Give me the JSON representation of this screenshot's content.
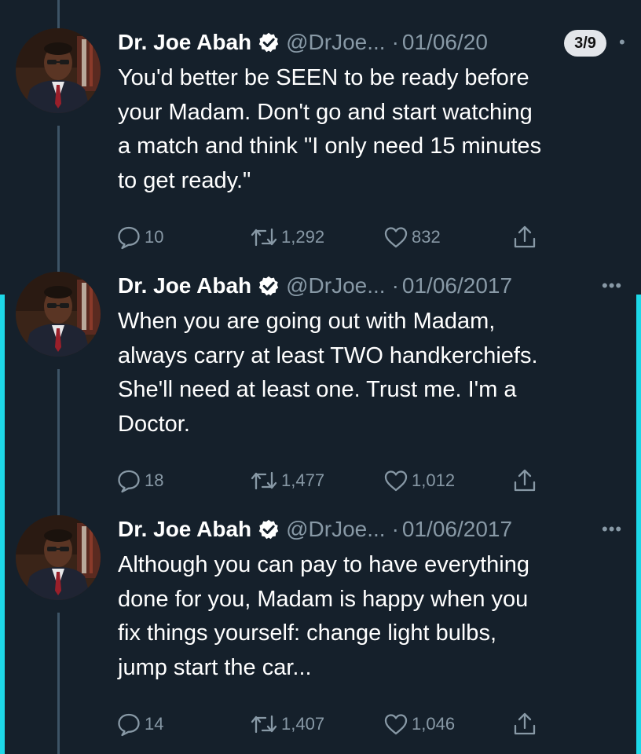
{
  "tweets": [
    {
      "name": "Dr. Joe Abah",
      "handle": "@DrJoe...",
      "date": "01/06/20",
      "text_lines": [
        "You'd better be SEEN to be ready before",
        "your Madam. Don't go and start watching",
        "a match and think \"I only need 15 minutes",
        "to get ready.\""
      ],
      "replies": "10",
      "retweets": "1,292",
      "likes": "832"
    },
    {
      "name": "Dr. Joe Abah",
      "handle": "@DrJoe...",
      "date": "01/06/2017",
      "text_lines": [
        "When you are going out with Madam,",
        "always carry at least TWO handkerchiefs.",
        "She'll need at least one. Trust me. I'm a",
        "Doctor."
      ],
      "replies": "18",
      "retweets": "1,477",
      "likes": "1,012"
    },
    {
      "name": "Dr. Joe Abah",
      "handle": "@DrJoe...",
      "date": "01/06/2017",
      "text_lines": [
        "Although you can pay to have everything",
        "done for you, Madam is happy when you",
        "fix things yourself: change light bulbs,",
        "jump start the car..."
      ],
      "replies": "14",
      "retweets": "1,407",
      "likes": "1,046"
    }
  ],
  "page_badge": "3/9",
  "separator": "·",
  "more_label": "•••",
  "icons": {
    "reply": "reply-icon",
    "retweet": "retweet-icon",
    "like": "heart-icon",
    "share": "share-icon",
    "verified": "verified-icon",
    "more": "more-icon"
  },
  "colors": {
    "background": "#15202b",
    "text": "#ffffff",
    "muted": "#8899a6",
    "thread_line": "#3d5466",
    "edge_accent": "#1dd8e8"
  }
}
